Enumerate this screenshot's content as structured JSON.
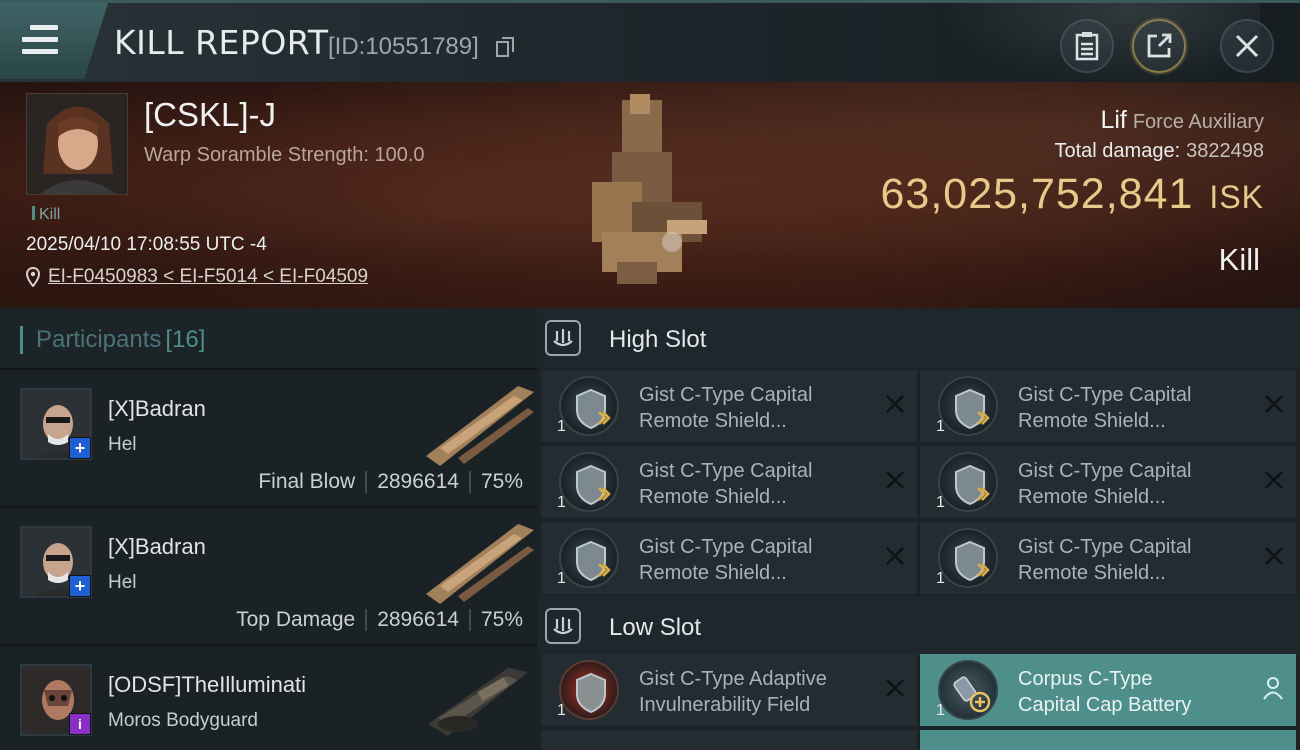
{
  "header": {
    "title": "KILL REPORT",
    "report_id": "[ID:10551789]"
  },
  "victim": {
    "name": "[CSKL]-J",
    "scramble": "Warp Soramble Strength: 100.0",
    "tag": "Kill",
    "datetime": "2025/04/10 17:08:55 UTC -4",
    "location": "EI-F0450983 < EI-F5014 < EI-F04509",
    "ship_name": "Lif",
    "ship_class": "Force Auxiliary",
    "total_damage_label": "Total damage:",
    "total_damage": "3822498",
    "isk_value": "63,025,752,841",
    "isk_unit": "ISK",
    "result": "Kill"
  },
  "participants": {
    "label": "Participants",
    "count": "[16]",
    "rows": [
      {
        "name": "[X]Badran",
        "ship": "Hel",
        "role": "Final Blow",
        "damage": "2896614",
        "percent": "75%",
        "badge": "+",
        "badge_color": "#1f5fd0"
      },
      {
        "name": "[X]Badran",
        "ship": "Hel",
        "role": "Top Damage",
        "damage": "2896614",
        "percent": "75%",
        "badge": "+",
        "badge_color": "#1f5fd0"
      },
      {
        "name": "[ODSF]TheIlluminati",
        "ship": "Moros Bodyguard",
        "role": "",
        "damage": "",
        "percent": "",
        "badge": "i",
        "badge_color": "#8a2fc6"
      }
    ]
  },
  "fitting": {
    "high_slot_label": "High Slot",
    "low_slot_label": "Low Slot",
    "high_modules": [
      {
        "qty": "1",
        "name_line1": "Gist C-Type Capital",
        "name_line2": "Remote Shield..."
      },
      {
        "qty": "1",
        "name_line1": "Gist C-Type Capital",
        "name_line2": "Remote Shield..."
      },
      {
        "qty": "1",
        "name_line1": "Gist C-Type Capital",
        "name_line2": "Remote Shield..."
      },
      {
        "qty": "1",
        "name_line1": "Gist C-Type Capital",
        "name_line2": "Remote Shield..."
      },
      {
        "qty": "1",
        "name_line1": "Gist C-Type Capital",
        "name_line2": "Remote Shield..."
      },
      {
        "qty": "1",
        "name_line1": "Gist C-Type Capital",
        "name_line2": "Remote Shield..."
      }
    ],
    "low_modules": [
      {
        "qty": "1",
        "name_line1": "Gist C-Type Adaptive",
        "name_line2": "Invulnerability Field"
      },
      {
        "qty": "1",
        "name_line1": "Corpus C-Type",
        "name_line2": "Capital Cap Battery"
      }
    ]
  }
}
